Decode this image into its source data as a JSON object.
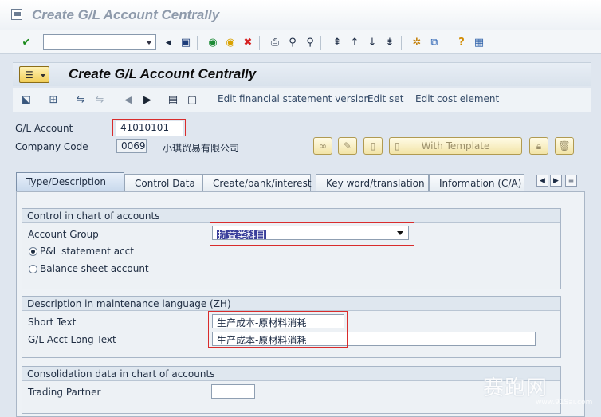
{
  "window": {
    "title": "Create G/L Account Centrally"
  },
  "screen": {
    "title": "Create G/L Account Centrally"
  },
  "app_toolbar": {
    "edit_fs_version": "Edit financial statement version",
    "edit_set": "Edit set",
    "edit_cost_element": "Edit cost element"
  },
  "header": {
    "gl_account_label": "G/L Account",
    "gl_account_value": "41010101",
    "company_code_label": "Company Code",
    "company_code_value": "0069",
    "company_name": "小琪贸易有限公司",
    "with_template": "With Template"
  },
  "tabs": [
    {
      "label": "Type/Description"
    },
    {
      "label": "Control Data"
    },
    {
      "label": "Create/bank/interest"
    },
    {
      "label": "Key word/translation"
    },
    {
      "label": "Information (C/A)"
    }
  ],
  "group_coa": {
    "title": "Control in chart of accounts",
    "account_group_label": "Account Group",
    "account_group_value": "损益类科目",
    "radio_pl": "P&L statement acct",
    "radio_bs": "Balance sheet account"
  },
  "group_desc": {
    "title": "Description in maintenance language (ZH)",
    "short_text_label": "Short Text",
    "short_text_value": "生产成本-原材料消耗",
    "long_text_label": "G/L Acct Long Text",
    "long_text_value": "生产成本-原材料消耗"
  },
  "group_consol": {
    "title": "Consolidation data in chart of accounts",
    "trading_partner_label": "Trading Partner",
    "trading_partner_value": ""
  },
  "watermark": {
    "text": "赛跑网",
    "url": "www.91Sai.com"
  }
}
